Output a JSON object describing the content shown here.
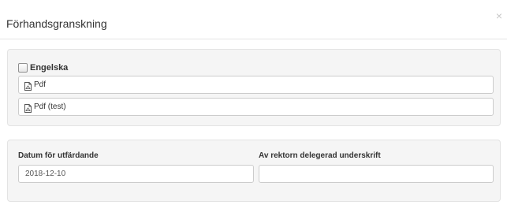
{
  "header": {
    "title": "Förhandsgranskning",
    "close_symbol": "×"
  },
  "languages": {
    "checkbox_label": "Engelska",
    "checkbox_checked": false,
    "documents": [
      {
        "label": "Pdf",
        "icon": "pdf-file-icon"
      },
      {
        "label": "Pdf (test)",
        "icon": "pdf-file-icon"
      }
    ]
  },
  "fields": {
    "date": {
      "label": "Datum för utfärdande",
      "value": "2018-12-10"
    },
    "signature": {
      "label": "Av rektorn delegerad underskrift",
      "value": ""
    }
  },
  "colors": {
    "well_background": "#f5f5f5",
    "border": "#cccccc",
    "text": "#333333"
  }
}
